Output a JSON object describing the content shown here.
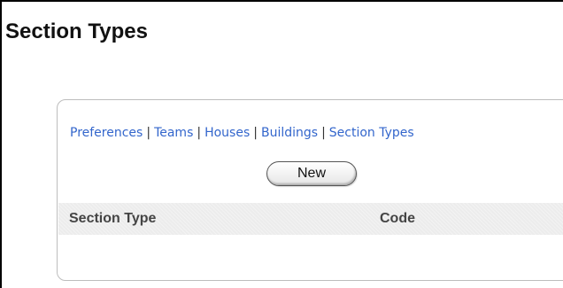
{
  "page": {
    "title": "Section Types"
  },
  "nav": {
    "items": [
      {
        "label": "Preferences"
      },
      {
        "label": "Teams"
      },
      {
        "label": "Houses"
      },
      {
        "label": "Buildings"
      },
      {
        "label": "Section Types"
      }
    ],
    "separator": "|",
    "link_color": "#3366cc"
  },
  "toolbar": {
    "new_label": "New"
  },
  "table": {
    "columns": [
      "Section Type",
      "Code"
    ],
    "rows": []
  }
}
